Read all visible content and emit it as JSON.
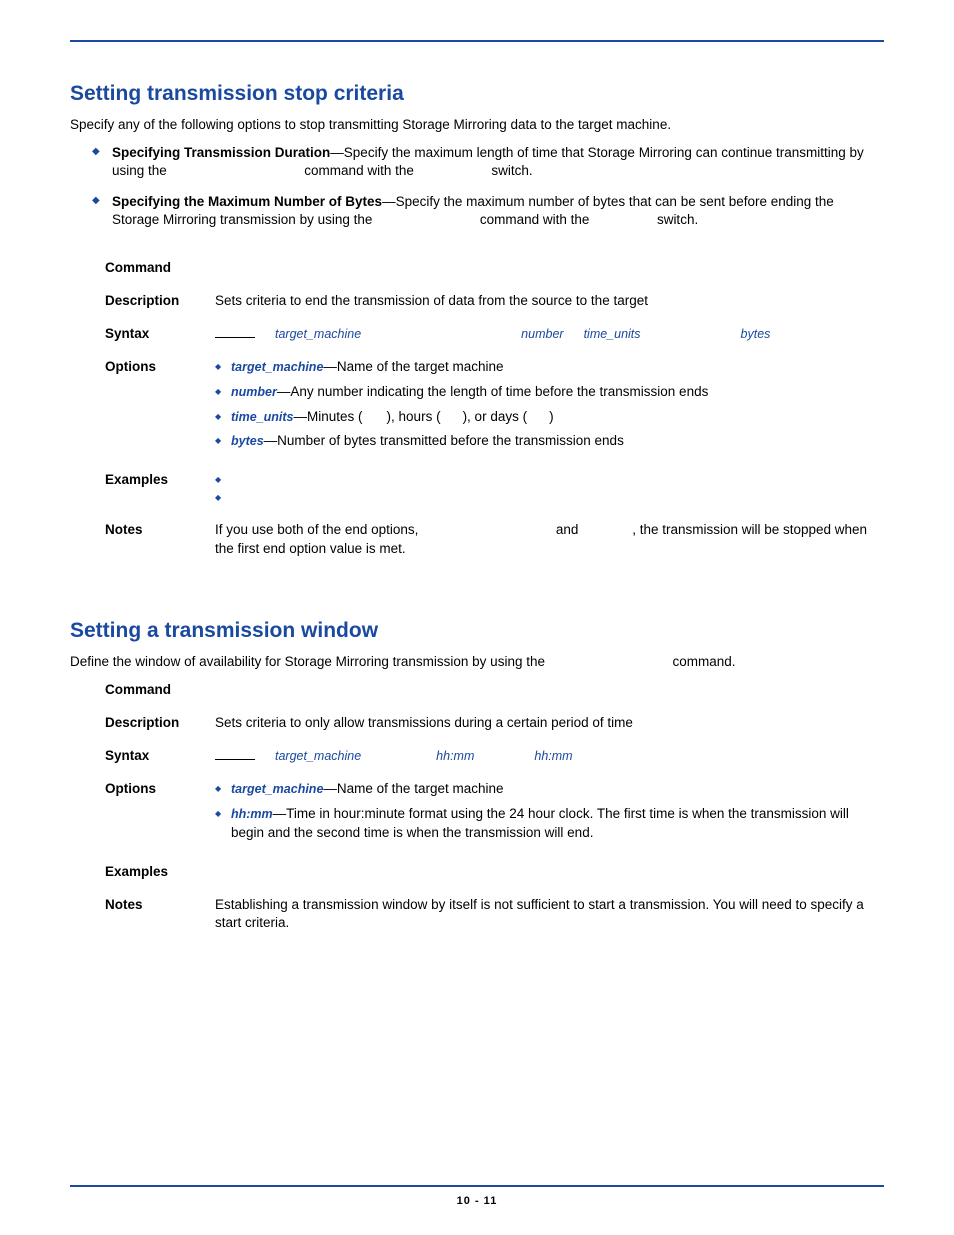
{
  "section1": {
    "heading": "Setting transmission stop criteria",
    "intro": "Specify any of the following options to stop transmitting Storage Mirroring data to the target machine.",
    "bullets": [
      {
        "lead": "Specifying Transmission Duration",
        "text_a": "—Specify the maximum length of time that Storage Mirroring can continue transmitting by using the ",
        "text_b": " command with the ",
        "text_c": " switch."
      },
      {
        "lead": "Specifying the Maximum Number of Bytes",
        "text_a": "—Specify the maximum number of bytes that can be sent before ending the Storage Mirroring transmission by using the ",
        "text_b": " command with the ",
        "text_c": " switch."
      }
    ],
    "table": {
      "command_label": "Command",
      "description_label": "Description",
      "description": "Sets criteria to end the transmission of data from the source to the target",
      "syntax_label": "Syntax",
      "syntax": {
        "p1": "target_machine",
        "p2": "number",
        "p3": "time_units",
        "p4": "bytes"
      },
      "options_label": "Options",
      "options": [
        {
          "name": "target_machine",
          "desc": "—Name of the target machine"
        },
        {
          "name": "number",
          "desc": "—Any number indicating the length of time before the transmission ends"
        },
        {
          "name": "time_units",
          "desc_pre": "—Minutes (",
          "desc_mid1": "), hours (",
          "desc_mid2": "), or days (",
          "desc_post": ")"
        },
        {
          "name": "bytes",
          "desc": "—Number of bytes transmitted before the transmission ends"
        }
      ],
      "examples_label": "Examples",
      "notes_label": "Notes",
      "notes_a": "If you use both of the end options, ",
      "notes_b": " and ",
      "notes_c": ", the transmission will be stopped when the first end option value is met."
    }
  },
  "section2": {
    "heading": "Setting a transmission window",
    "intro_a": "Define the window of availability for Storage Mirroring transmission by using the ",
    "intro_b": " command.",
    "table": {
      "command_label": "Command",
      "description_label": "Description",
      "description": "Sets criteria to only allow transmissions during a certain period of time",
      "syntax_label": "Syntax",
      "syntax": {
        "p1": "target_machine",
        "p2": "hh:mm",
        "p3": "hh:mm"
      },
      "options_label": "Options",
      "options": [
        {
          "name": "target_machine",
          "desc": "—Name of the target machine"
        },
        {
          "name": "hh:mm",
          "desc": "—Time in hour:minute format using the 24 hour clock. The first time is when the transmission will begin and the second time is when the transmission will end."
        }
      ],
      "examples_label": "Examples",
      "notes_label": "Notes",
      "notes": "Establishing a transmission window by itself is not sufficient to start a transmission. You will need to specify a start criteria."
    }
  },
  "footer": "10 - 11"
}
